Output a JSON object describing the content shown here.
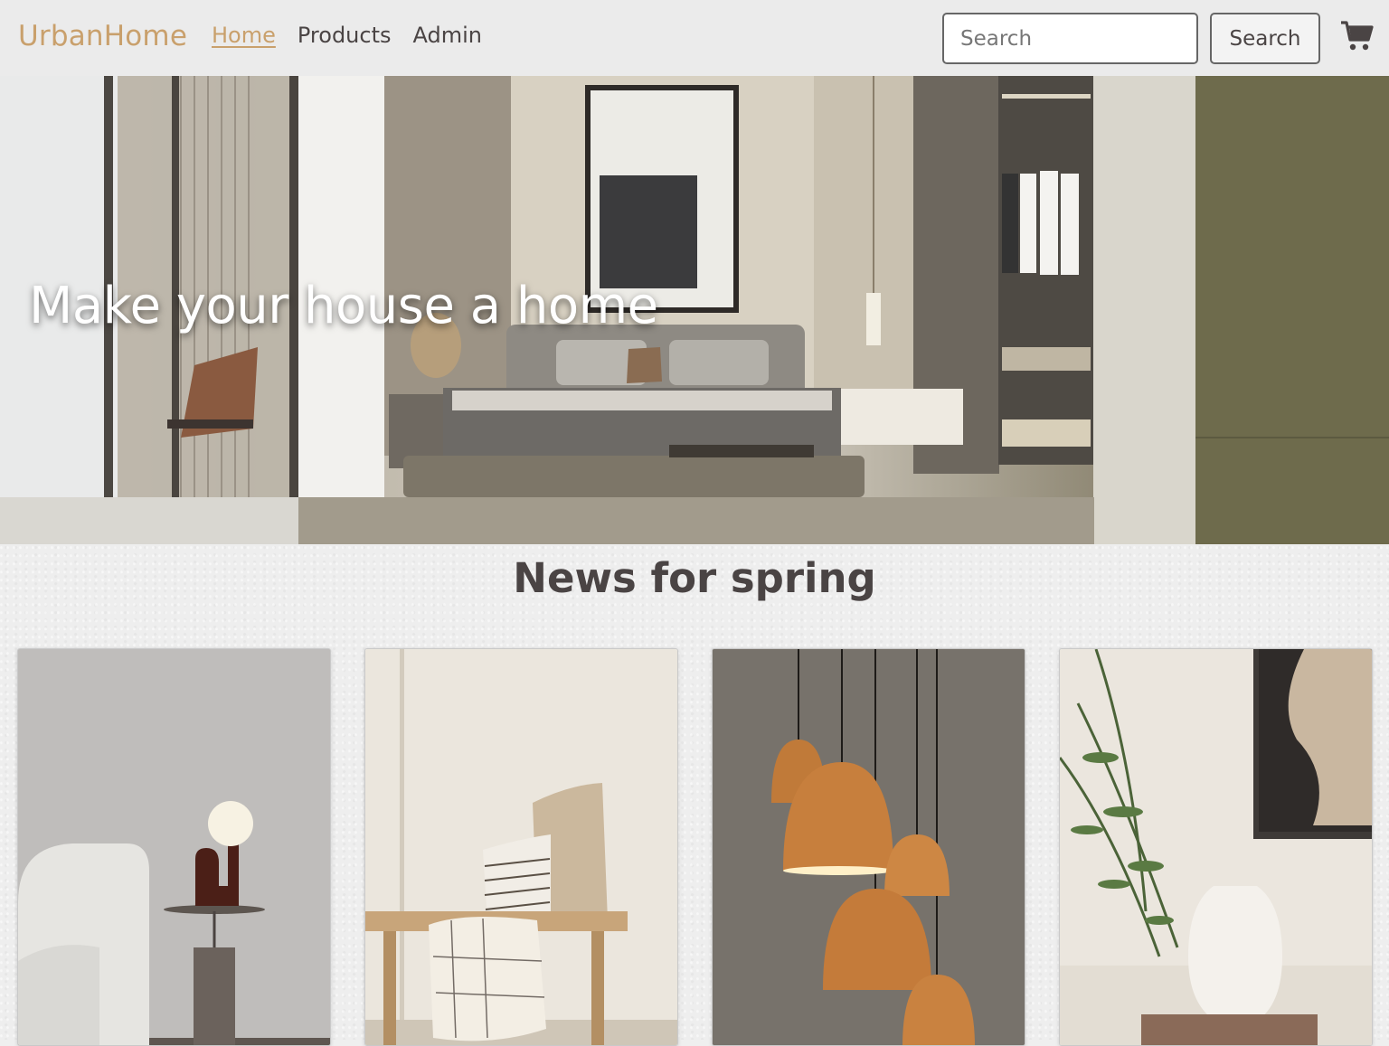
{
  "navbar": {
    "brand": "UrbanHome",
    "links": [
      {
        "label": "Home",
        "active": true
      },
      {
        "label": "Products",
        "active": false
      },
      {
        "label": "Admin",
        "active": false
      }
    ],
    "search": {
      "placeholder": "Search",
      "value": ""
    },
    "search_button_label": "Search",
    "cart_icon": "cart-icon"
  },
  "hero": {
    "title": "Make your house a home",
    "image": "bedroom-interior-photo"
  },
  "section": {
    "title": "News for spring"
  },
  "products": [
    {
      "image": "table-lamp-photo"
    },
    {
      "image": "bench-with-pillows-photo"
    },
    {
      "image": "copper-pendant-lamps-photo"
    },
    {
      "image": "white-vase-photo"
    }
  ],
  "colors": {
    "accent": "#c9a06c",
    "text": "#4a4444",
    "navbar_bg": "#ebebeb"
  }
}
